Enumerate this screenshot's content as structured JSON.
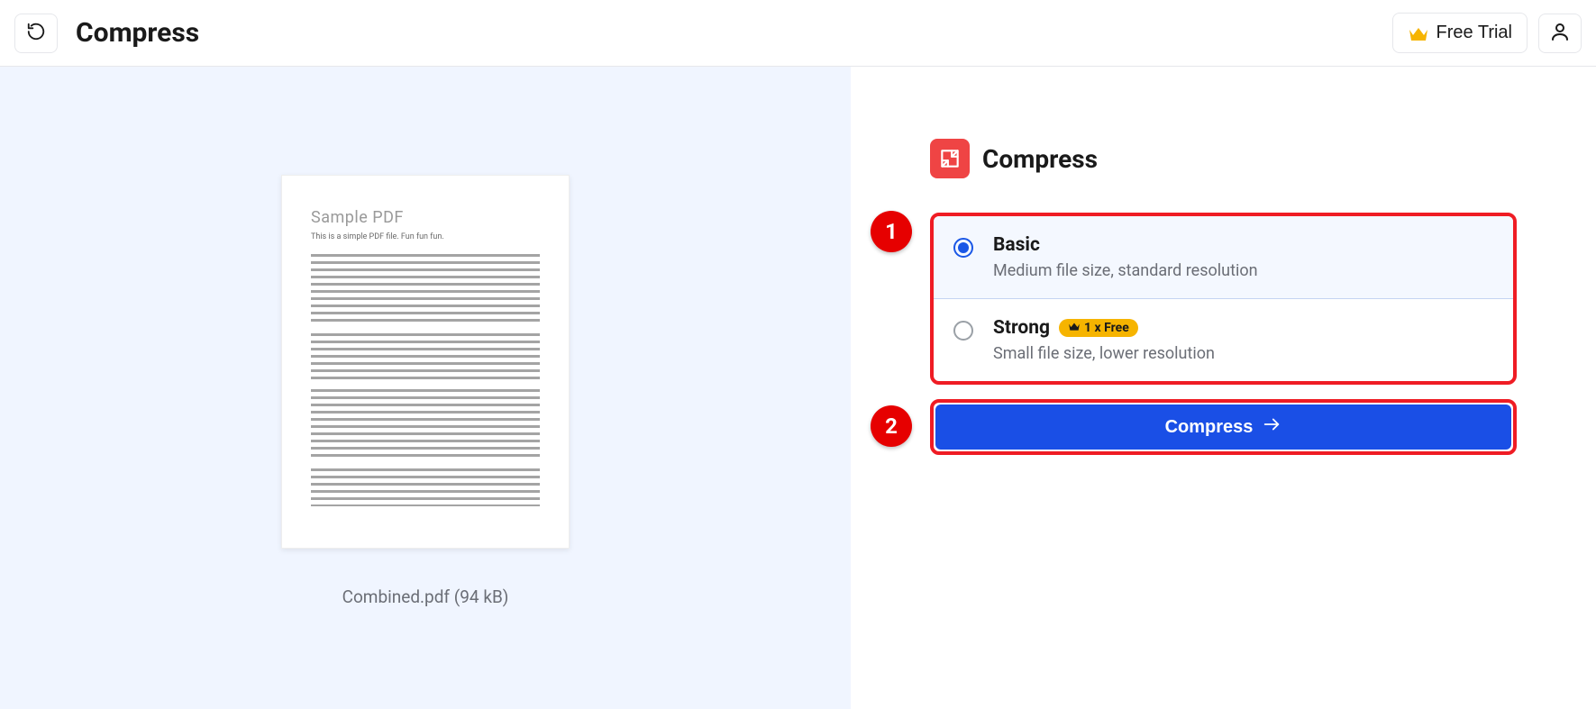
{
  "header": {
    "title": "Compress",
    "free_trial_label": "Free Trial"
  },
  "preview": {
    "doc_title": "Sample PDF",
    "doc_subtitle": "This is a simple PDF file. Fun fun fun.",
    "file_name": "Combined.pdf",
    "file_size": "(94 kB)"
  },
  "panel": {
    "title": "Compress",
    "options": [
      {
        "title": "Basic",
        "desc": "Medium file size, standard resolution",
        "selected": true
      },
      {
        "title": "Strong",
        "desc": "Small file size, lower resolution",
        "badge": "1 x Free"
      }
    ],
    "action_label": "Compress"
  },
  "steps": {
    "one": "1",
    "two": "2"
  }
}
